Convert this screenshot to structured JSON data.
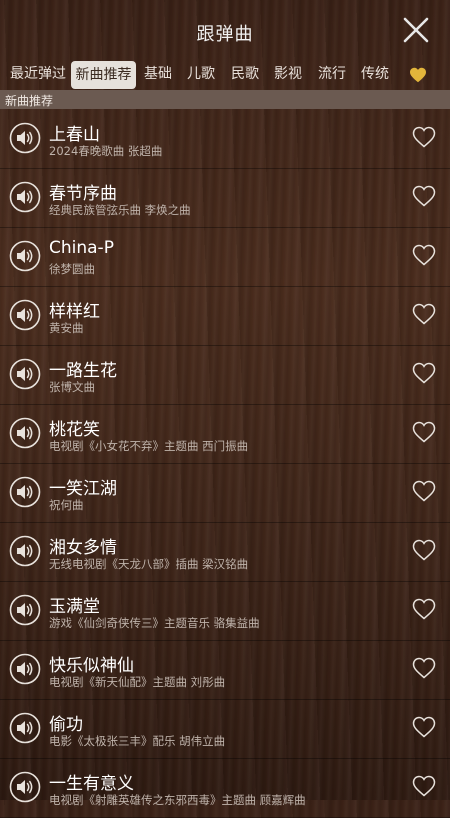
{
  "header": {
    "title": "跟弹曲"
  },
  "tabs": [
    {
      "label": "最近弹过"
    },
    {
      "label": "新曲推荐"
    },
    {
      "label": "基础"
    },
    {
      "label": "儿歌"
    },
    {
      "label": "民歌"
    },
    {
      "label": "影视"
    },
    {
      "label": "流行"
    },
    {
      "label": "传统"
    }
  ],
  "favorites_tab_color": "#e2b53b",
  "active_tab": "新曲推荐",
  "section": {
    "label": "新曲推荐"
  },
  "songs": [
    {
      "title": "上春山",
      "subtitle": "2024春晚歌曲 张超曲"
    },
    {
      "title": "春节序曲",
      "subtitle": "经典民族管弦乐曲 李焕之曲"
    },
    {
      "title": "China-P",
      "subtitle": "徐梦圆曲"
    },
    {
      "title": "样样红",
      "subtitle": "黄安曲"
    },
    {
      "title": "一路生花",
      "subtitle": "张博文曲"
    },
    {
      "title": "桃花笑",
      "subtitle": "电视剧《小女花不弃》主题曲 西门振曲"
    },
    {
      "title": "一笑江湖",
      "subtitle": "祝何曲"
    },
    {
      "title": "湘女多情",
      "subtitle": "无线电视剧《天龙八部》插曲 梁汉铭曲"
    },
    {
      "title": "玉满堂",
      "subtitle": "游戏《仙剑奇侠传三》主题音乐 骆集益曲"
    },
    {
      "title": "快乐似神仙",
      "subtitle": "电视剧《新天仙配》主题曲 刘彤曲"
    },
    {
      "title": "偷功",
      "subtitle": "电影《太极张三丰》配乐 胡伟立曲"
    },
    {
      "title": "一生有意义",
      "subtitle": "电视剧《射雕英雄传之东邪西毒》主题曲 顾嘉辉曲"
    }
  ]
}
